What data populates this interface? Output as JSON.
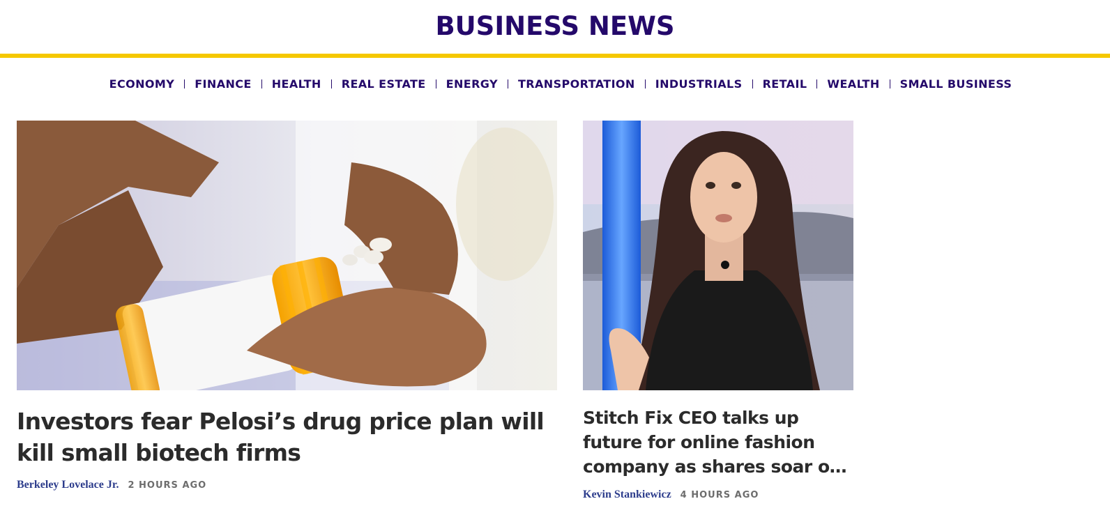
{
  "header": {
    "title": "BUSINESS NEWS"
  },
  "colors": {
    "brand": "#24096a",
    "accent_rule": "#f5c800",
    "author": "#2d3d8c",
    "headline": "#2b2b2b",
    "timestamp": "#6d6d6d"
  },
  "nav": {
    "items": [
      "ECONOMY",
      "FINANCE",
      "HEALTH",
      "REAL ESTATE",
      "ENERGY",
      "TRANSPORTATION",
      "INDUSTRIALS",
      "RETAIL",
      "WEALTH",
      "SMALL BUSINESS"
    ]
  },
  "articles": [
    {
      "headline": "Investors fear Pelosi’s drug price plan will kill small biotech firms",
      "author": "Berkeley Lovelace Jr.",
      "time": "2 HOURS AGO"
    },
    {
      "headline": "Stitch Fix CEO talks up future for online fashion company as shares soar on earnings",
      "author": "Kevin Stankiewicz",
      "time": "4 HOURS AGO"
    }
  ]
}
